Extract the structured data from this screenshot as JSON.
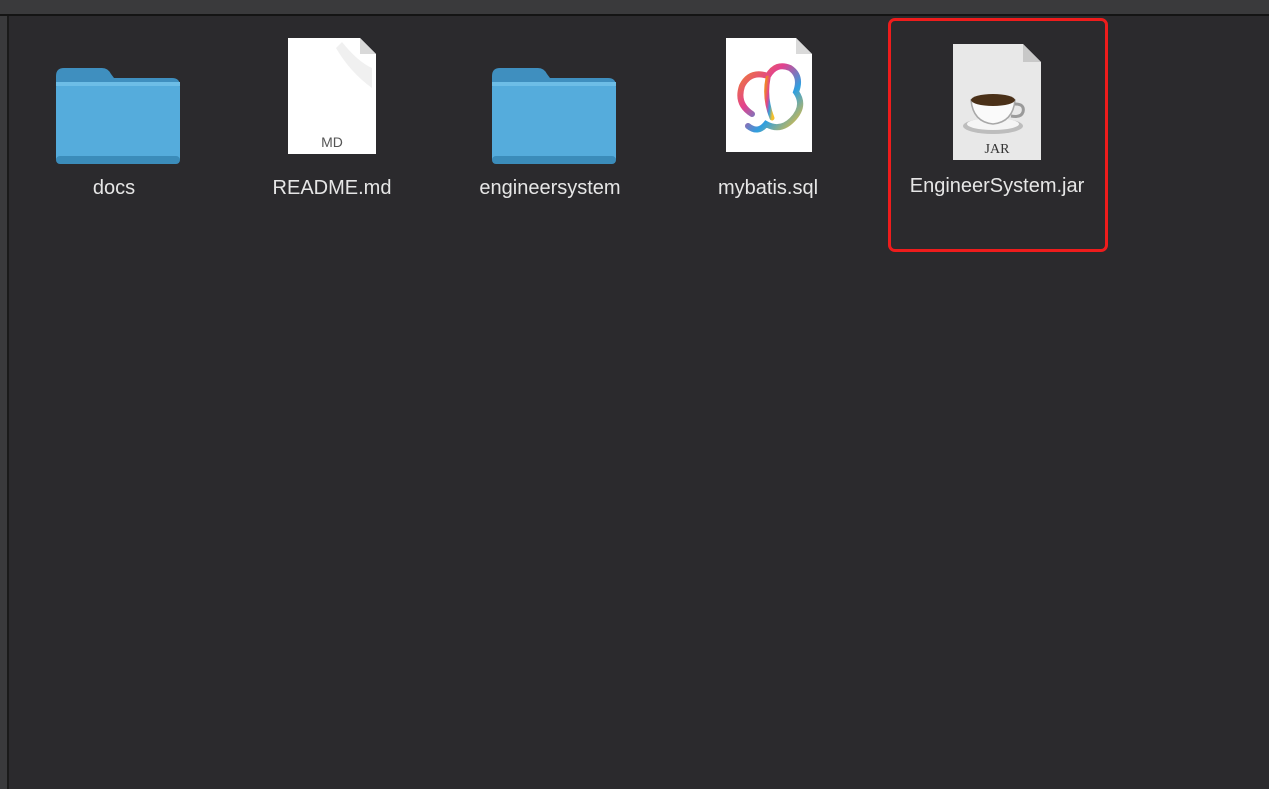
{
  "files": [
    {
      "name": "docs",
      "kind": "folder",
      "icon": "folder-icon"
    },
    {
      "name": "README.md",
      "kind": "document",
      "icon": "markdown-file-icon",
      "badge": "MD"
    },
    {
      "name": "engineersystem",
      "kind": "folder",
      "icon": "folder-icon"
    },
    {
      "name": "mybatis.sql",
      "kind": "sql",
      "icon": "navicat-sql-file-icon"
    },
    {
      "name": "EngineerSystem.jar",
      "kind": "jar",
      "icon": "java-jar-file-icon",
      "badge": "JAR",
      "selected": true
    }
  ],
  "colors": {
    "background": "#2b2a2d",
    "folder": "#4fa8d8",
    "selection_outline": "#ee1c1c",
    "label": "#e6e6e6"
  }
}
